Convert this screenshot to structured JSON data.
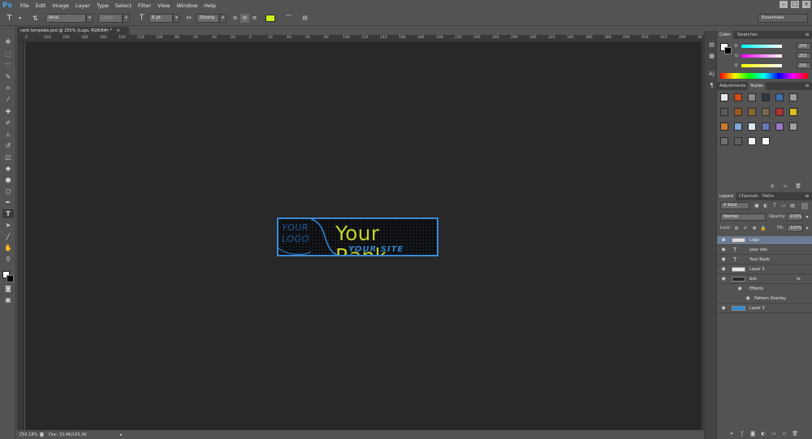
{
  "app": {
    "logo": "Ps"
  },
  "menu": [
    "File",
    "Edit",
    "Image",
    "Layer",
    "Type",
    "Select",
    "Filter",
    "View",
    "Window",
    "Help"
  ],
  "options_bar": {
    "font_family": "Arial",
    "font_style": "Light",
    "font_size": "6 pt",
    "aa_label": "aa",
    "anti_alias": "Strong",
    "text_color": "#c9f21a",
    "workspace": "Essentials"
  },
  "document": {
    "tab_title": "rank template.psd @ 255% (Logo, RGB/8#) *",
    "close_glyph": "×",
    "zoom": "255.18%",
    "doc_size": "Doc: 15.4K/163.3K"
  },
  "ruler": {
    "h_ticks": [
      "0",
      "220",
      "200",
      "180",
      "160",
      "140",
      "120",
      "100",
      "80",
      "60",
      "40",
      "20",
      "0",
      "20",
      "40",
      "60",
      "80",
      "100",
      "120",
      "140",
      "160",
      "180",
      "200",
      "220",
      "240",
      "260",
      "280",
      "300",
      "320",
      "340",
      "360",
      "380",
      "400",
      "420",
      "440",
      "460",
      "480"
    ]
  },
  "banner": {
    "logo_line1": "YOUR",
    "logo_line2": "LOGO",
    "rank_text": "Your Rank",
    "site_text": "YOUR SITE"
  },
  "color_panel": {
    "tabs": [
      "Color",
      "Swatches"
    ],
    "channels": [
      {
        "label": "R",
        "value": "255"
      },
      {
        "label": "G",
        "value": "255"
      },
      {
        "label": "B",
        "value": "255"
      }
    ]
  },
  "styles_panel": {
    "tabs": [
      "Adjustments",
      "Styles"
    ],
    "swatches": [
      "#e8e8e8",
      "#d24a1a",
      "#8a8a8a",
      "#303840",
      "#3a6fb0",
      "#9a9a9a",
      "#5a5a5a",
      "#9a5a20",
      "#8a6a30",
      "#7a6a50",
      "#b23030",
      "#d4c020",
      "#c87a30",
      "#7aa8d8",
      "#d8e8f0",
      "#6a78b8",
      "#9a78c8",
      "#a0a0a0",
      "#707070",
      "#606060",
      "#f4f4f4",
      "#f8f8f8"
    ]
  },
  "layers_panel": {
    "tabs": [
      "Layers",
      "Channels",
      "Paths"
    ],
    "filter": "Kind",
    "blend_mode": "Normal",
    "opacity_label": "Opacity:",
    "opacity": "100%",
    "lock_label": "Lock:",
    "fill_label": "Fill:",
    "fill": "100%",
    "layers": [
      {
        "name": "Logo",
        "kind": "pixel",
        "selected": true
      },
      {
        "name": "your site",
        "kind": "text",
        "selected": false
      },
      {
        "name": "Your Rank",
        "kind": "text",
        "selected": false
      },
      {
        "name": "Layer 2",
        "kind": "pixel",
        "selected": false
      },
      {
        "name": "bck",
        "kind": "pixel",
        "selected": false,
        "fx": "fx"
      },
      {
        "name": "Effects",
        "kind": "effects",
        "selected": false
      },
      {
        "name": "Pattern Overlay",
        "kind": "effect",
        "selected": false
      },
      {
        "name": "Layer 3",
        "kind": "pixel-blue",
        "selected": false
      }
    ]
  }
}
